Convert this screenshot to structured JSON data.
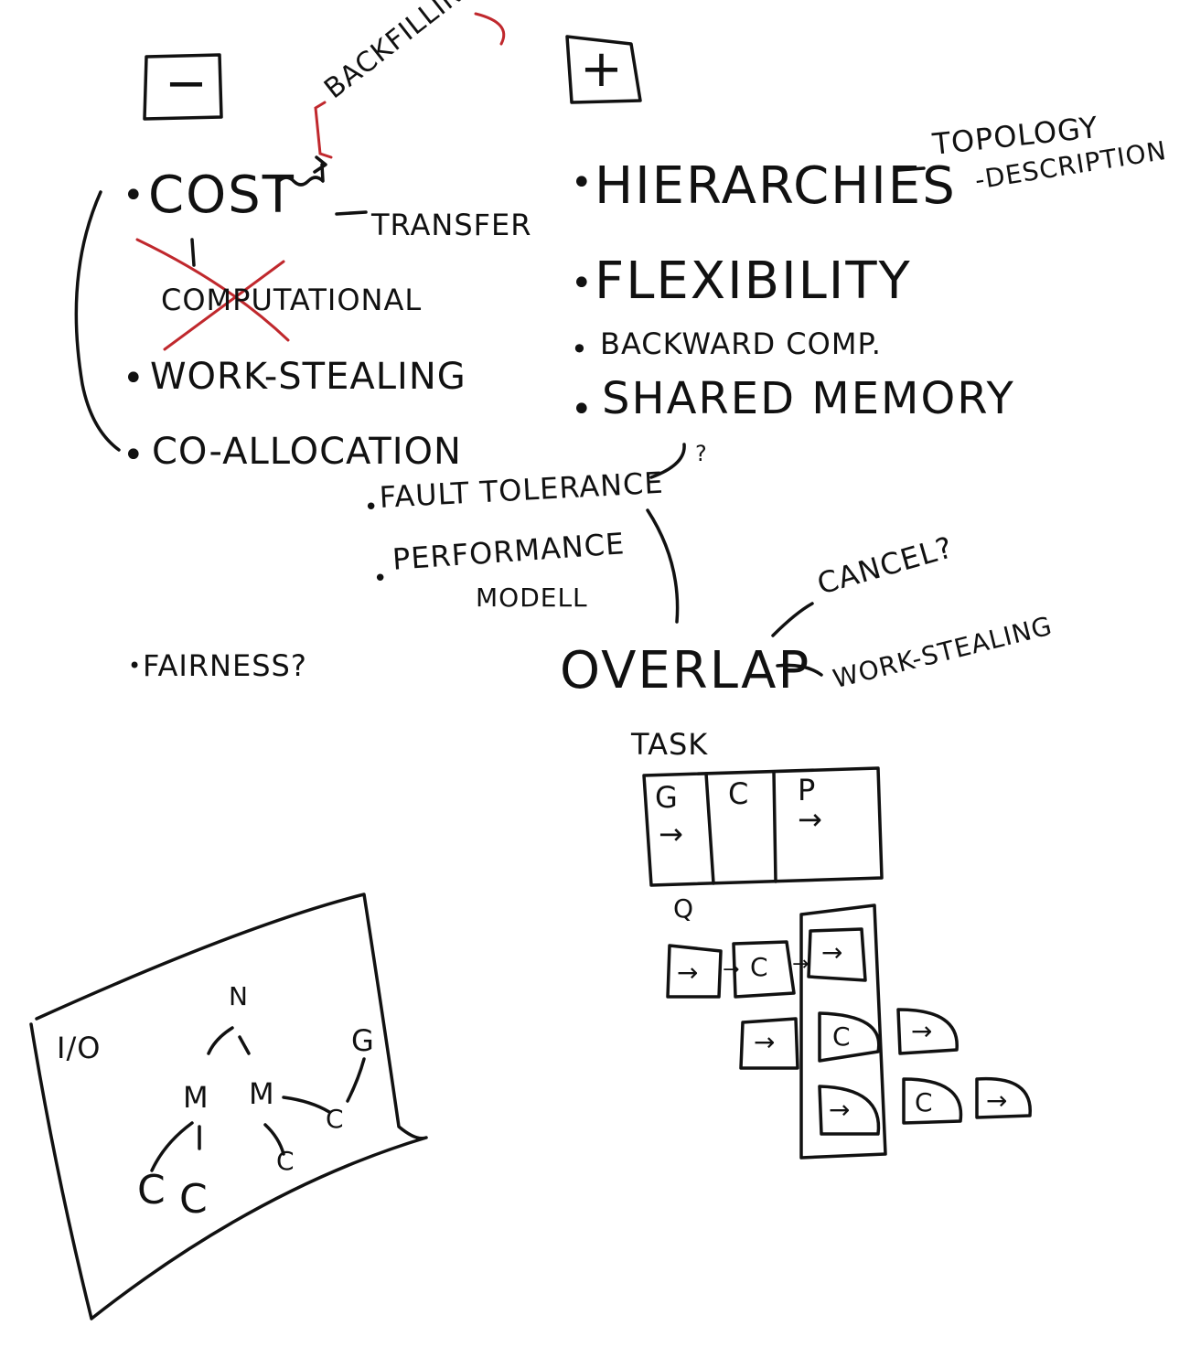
{
  "board": {
    "minus_box": "−",
    "plus_box": "+",
    "backfilling": "BACKFILLING",
    "cost": "COST",
    "transfer": "TRANSFER",
    "computational": "COMPUTATIONAL",
    "work_stealing": "WORK-STEALING",
    "co_allocation": "CO-ALLOCATION",
    "hierarchies": "HIERARCHIES",
    "topology": "TOPOLOGY",
    "description": "-DESCRIPTION",
    "flexibility": "FLEXIBILITY",
    "backward_comp": "BACKWARD COMP.",
    "shared_memory": "SHARED MEMORY",
    "shared_memory_mark": "?",
    "fault_tolerance": "FAULT TOLERANCE",
    "performance": "PERFORMANCE",
    "modell": "MODELL",
    "fairness": "FAIRNESS?",
    "overlap": "OVERLAP",
    "cancel": "CANCEL?",
    "overlap_work_stealing": "WORK-STEALING",
    "task": "TASK",
    "task_cells": [
      "G",
      "C",
      "P"
    ],
    "task_arrow": "→",
    "queue_marker": "Q",
    "pipeline_arrow": "→",
    "pipeline_compute": "C",
    "io_label": "I/O",
    "tree_root": "N",
    "tree_m": "M",
    "tree_c": "C",
    "tree_g": "G",
    "bullet": "•"
  },
  "colors": {
    "ink": "#111111",
    "correction": "#c0282d",
    "background": "#ffffff"
  }
}
